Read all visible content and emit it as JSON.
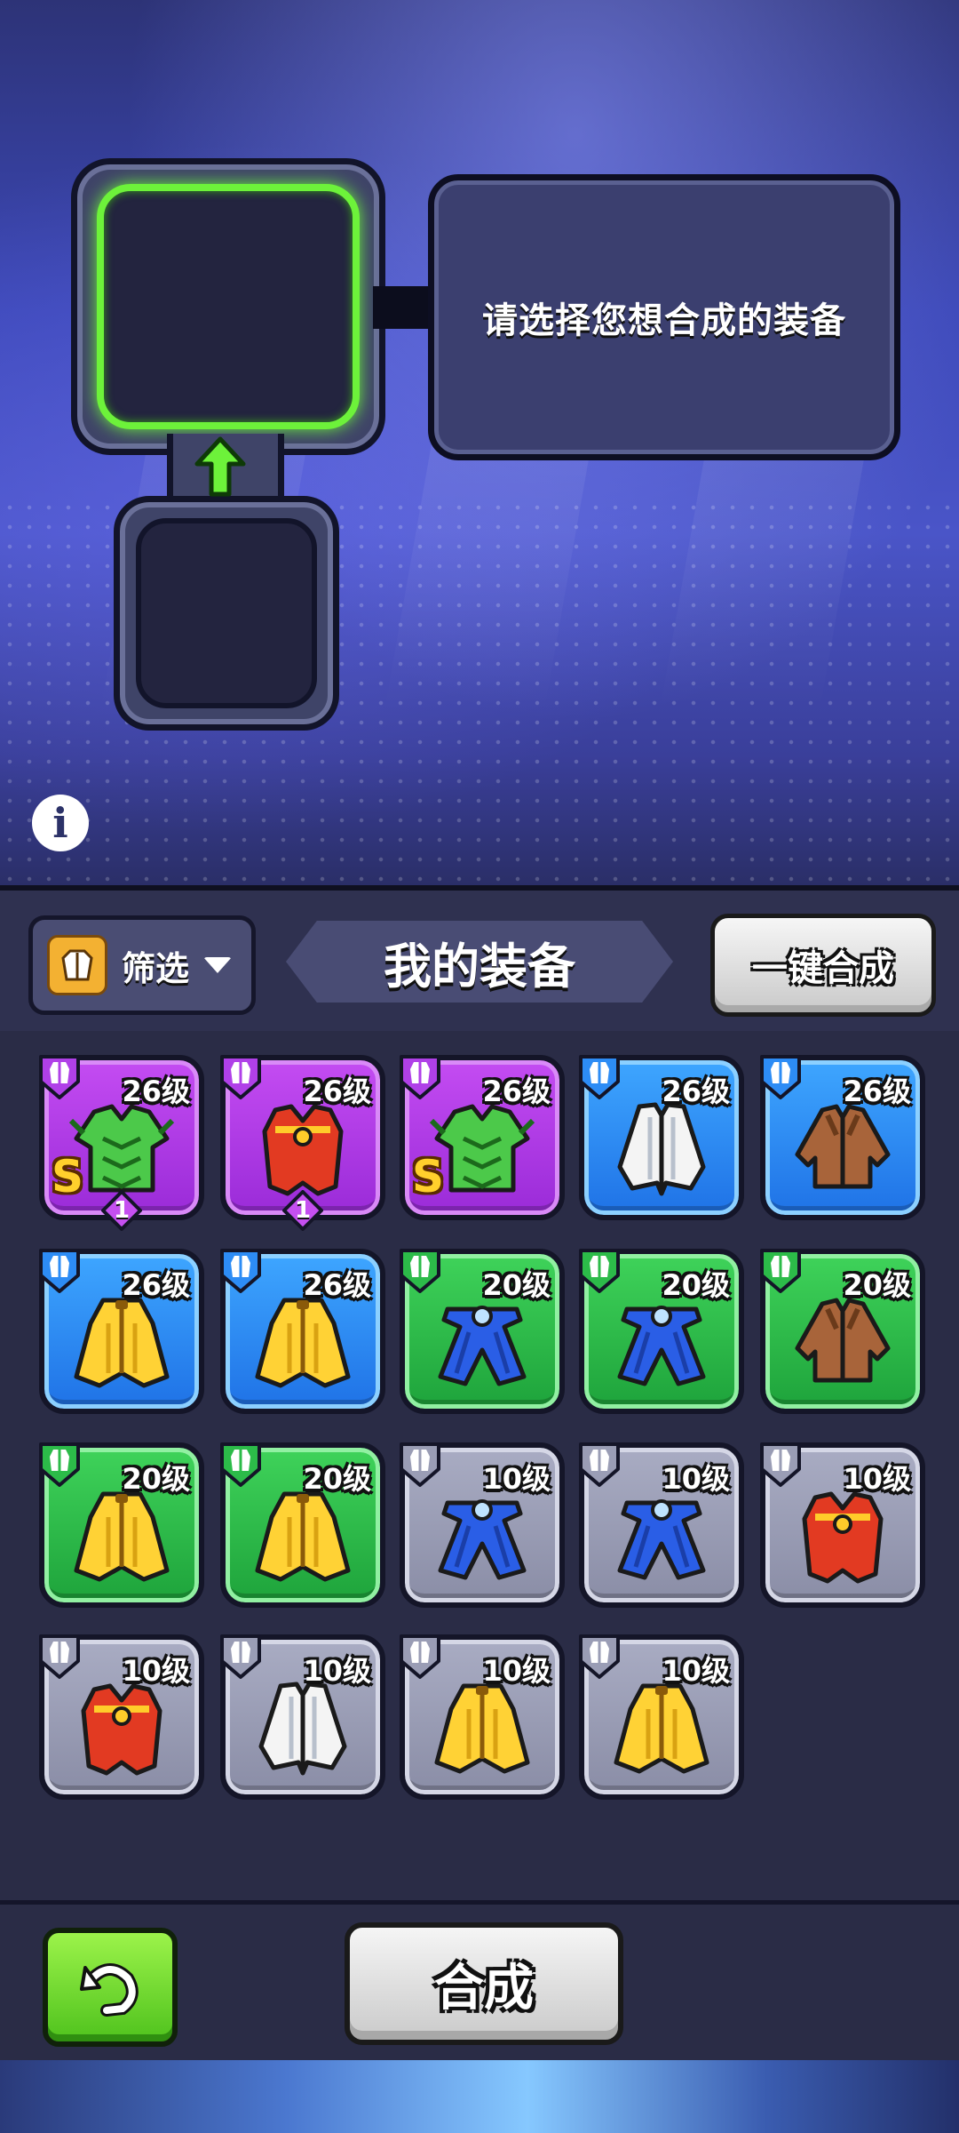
{
  "hint": {
    "text": "请选择您想合成的装备"
  },
  "panel": {
    "filter_label": "筛选",
    "title": "我的装备",
    "one_click_label": "一键合成"
  },
  "footer": {
    "merge_label": "合成"
  },
  "colors": {
    "purple": "#b040e8",
    "blue": "#2d8cf5",
    "green": "#2cbb49",
    "gray": "#9a9db5",
    "select_glow": "#6df23a"
  },
  "equipment": [
    {
      "level": "26级",
      "tier": "purple",
      "item": "green-armor-icon",
      "rank": "S",
      "count": "1"
    },
    {
      "level": "26级",
      "tier": "purple",
      "item": "red-vest-icon",
      "rank": "",
      "count": "1"
    },
    {
      "level": "26级",
      "tier": "purple",
      "item": "green-armor-icon",
      "rank": "S",
      "count": ""
    },
    {
      "level": "26级",
      "tier": "blue",
      "item": "white-coat-icon",
      "rank": "",
      "count": ""
    },
    {
      "level": "26级",
      "tier": "blue",
      "item": "brown-jacket-icon",
      "rank": "",
      "count": ""
    },
    {
      "level": "26级",
      "tier": "blue",
      "item": "yellow-robe-icon",
      "rank": "",
      "count": ""
    },
    {
      "level": "26级",
      "tier": "blue",
      "item": "yellow-robe-icon",
      "rank": "",
      "count": ""
    },
    {
      "level": "20级",
      "tier": "green",
      "item": "blue-cape-icon",
      "rank": "",
      "count": ""
    },
    {
      "level": "20级",
      "tier": "green",
      "item": "blue-cape-icon",
      "rank": "",
      "count": ""
    },
    {
      "level": "20级",
      "tier": "green",
      "item": "brown-jacket-icon",
      "rank": "",
      "count": ""
    },
    {
      "level": "20级",
      "tier": "green",
      "item": "yellow-robe-icon",
      "rank": "",
      "count": ""
    },
    {
      "level": "20级",
      "tier": "green",
      "item": "yellow-robe-icon",
      "rank": "",
      "count": ""
    },
    {
      "level": "10级",
      "tier": "gray",
      "item": "blue-cape-icon",
      "rank": "",
      "count": ""
    },
    {
      "level": "10级",
      "tier": "gray",
      "item": "blue-cape-icon",
      "rank": "",
      "count": ""
    },
    {
      "level": "10级",
      "tier": "gray",
      "item": "red-vest-icon",
      "rank": "",
      "count": ""
    },
    {
      "level": "10级",
      "tier": "gray",
      "item": "red-vest-icon",
      "rank": "",
      "count": ""
    },
    {
      "level": "10级",
      "tier": "gray",
      "item": "white-coat-icon",
      "rank": "",
      "count": ""
    },
    {
      "level": "10级",
      "tier": "gray",
      "item": "yellow-robe-icon",
      "rank": "",
      "count": ""
    },
    {
      "level": "10级",
      "tier": "gray",
      "item": "yellow-robe-icon",
      "rank": "",
      "count": ""
    }
  ]
}
